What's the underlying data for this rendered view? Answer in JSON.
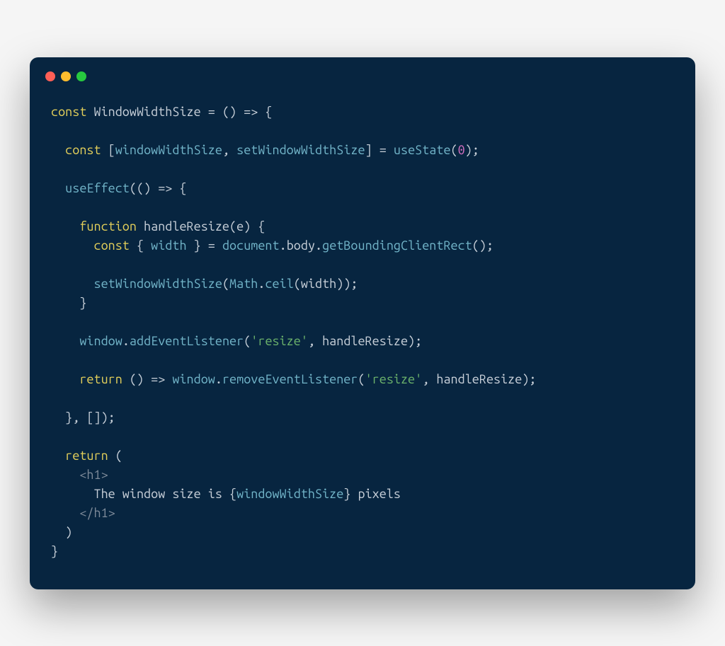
{
  "window": {
    "dots": {
      "close": "#ff5f56",
      "minimize": "#ffbd2e",
      "zoom": "#27c93f"
    }
  },
  "code": {
    "line1": {
      "kw1": "const",
      "name": " WindowWidthSize ",
      "eq": "= ",
      "arrow": "() => {"
    },
    "line3": {
      "kw": "const",
      "open": " [",
      "v1": "windowWidthSize",
      "comma": ", ",
      "v2": "setWindowWidthSize",
      "close": "] = ",
      "fn": "useState",
      "paren": "(",
      "num": "0",
      "end": ");"
    },
    "line5": {
      "fn": "useEffect",
      "rest": "(() => {"
    },
    "line7": {
      "kw": "function",
      "name": " handleResize",
      "sig": "(e) {"
    },
    "line8": {
      "kw": "const",
      "open": " { ",
      "v": "width",
      "close": " } = ",
      "obj": "document",
      "dot1": ".",
      "p1": "body",
      "dot2": ".",
      "fn": "getBoundingClientRect",
      "end": "();"
    },
    "line10": {
      "fn": "setWindowWidthSize",
      "open": "(",
      "obj": "Math",
      "dot": ".",
      "m": "ceil",
      "args": "(width));"
    },
    "line11": {
      "close": "}"
    },
    "line13": {
      "obj": "window",
      "dot": ".",
      "fn": "addEventListener",
      "open": "(",
      "str": "'resize'",
      "rest": ", handleResize);"
    },
    "line15": {
      "kw": "return",
      "arrow": " () => ",
      "obj": "window",
      "dot": ".",
      "fn": "removeEventListener",
      "open": "(",
      "str": "'resize'",
      "rest": ", handleResize);"
    },
    "line17": {
      "close": "}, []);"
    },
    "line19": {
      "kw": "return",
      "rest": " ("
    },
    "line20": {
      "tag": "<h1>"
    },
    "line21": {
      "txt": "The window size is ",
      "open": "{",
      "v": "windowWidthSize",
      "close": "}",
      "txt2": " pixels"
    },
    "line22": {
      "tag": "</h1>"
    },
    "line23": {
      "close": ")"
    },
    "line24": {
      "close": "}"
    }
  }
}
